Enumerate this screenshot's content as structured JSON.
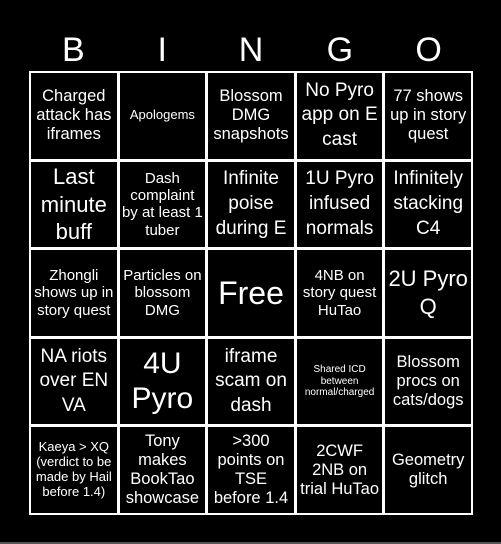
{
  "header": {
    "letters": [
      "B",
      "I",
      "N",
      "G",
      "O"
    ]
  },
  "board": {
    "cells": [
      "Charged attack has iframes",
      "Apologems",
      "Blossom DMG snapshots",
      "No Pyro app on E cast",
      "77 shows up in story quest",
      "Last minute buff",
      "Dash complaint by at least 1 tuber",
      "Infinite poise during E",
      "1U Pyro infused normals",
      "Infinitely stacking C4",
      "Zhongli shows up in story quest",
      "Particles on blossom DMG",
      "Free",
      "4NB on story quest HuTao",
      "2U Pyro Q",
      "NA riots over EN VA",
      "4U Pyro",
      "iframe scam on dash",
      "Shared ICD between normal/charged",
      "Blossom procs on cats/dogs",
      "Kaeya > XQ (verdict to be made by Hail before 1.4)",
      "Tony makes BookTao showcase",
      ">300 points on TSE before 1.4",
      "2CWF 2NB on trial HuTao",
      "Geometry glitch"
    ]
  },
  "colors": {
    "background": "#000000",
    "grid": "#ffffff",
    "text": "#ffffff"
  }
}
